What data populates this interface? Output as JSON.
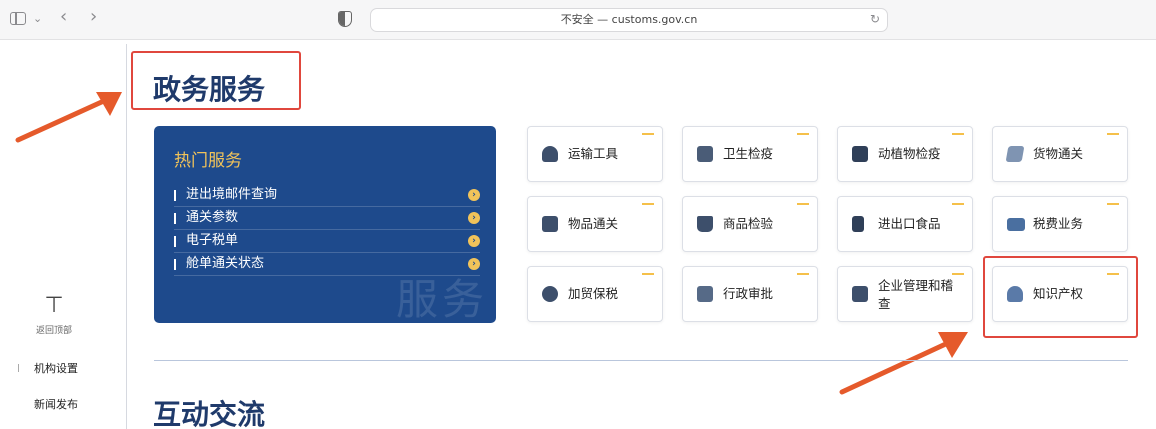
{
  "browser": {
    "address_text": "不安全 — customs.gov.cn"
  },
  "section_gov": {
    "title": "政务服务",
    "hot": {
      "title": "热门服务",
      "items": [
        {
          "label": "进出境邮件查询"
        },
        {
          "label": "通关参数"
        },
        {
          "label": "电子税单"
        },
        {
          "label": "舱单通关状态"
        }
      ],
      "watermark": "服务"
    },
    "tiles": [
      {
        "label": "运输工具",
        "icon": "ship-icon"
      },
      {
        "label": "卫生检疫",
        "icon": "hygiene-icon"
      },
      {
        "label": "动植物检疫",
        "icon": "plant-icon"
      },
      {
        "label": "货物通关",
        "icon": "goods-icon"
      },
      {
        "label": "物品通关",
        "icon": "items-icon"
      },
      {
        "label": "商品检验",
        "icon": "inspection-icon"
      },
      {
        "label": "进出口食品",
        "icon": "food-icon"
      },
      {
        "label": "税费业务",
        "icon": "tax-icon"
      },
      {
        "label": "加贸保税",
        "icon": "bonded-icon"
      },
      {
        "label": "行政审批",
        "icon": "approval-icon"
      },
      {
        "label": "企业管理和稽查",
        "icon": "enterprise-icon"
      },
      {
        "label": "知识产权",
        "icon": "ip-icon"
      }
    ]
  },
  "section_interact": {
    "title": "互动交流"
  },
  "left_nav": {
    "back_to_top": "返回顶部",
    "items": [
      {
        "label": "机构设置"
      },
      {
        "label": "新闻发布"
      }
    ]
  },
  "colors": {
    "panel_blue": "#1e4a8c",
    "accent_gold": "#f1c35a",
    "title_navy": "#1f3a6b",
    "highlight_red": "#e0473d"
  }
}
